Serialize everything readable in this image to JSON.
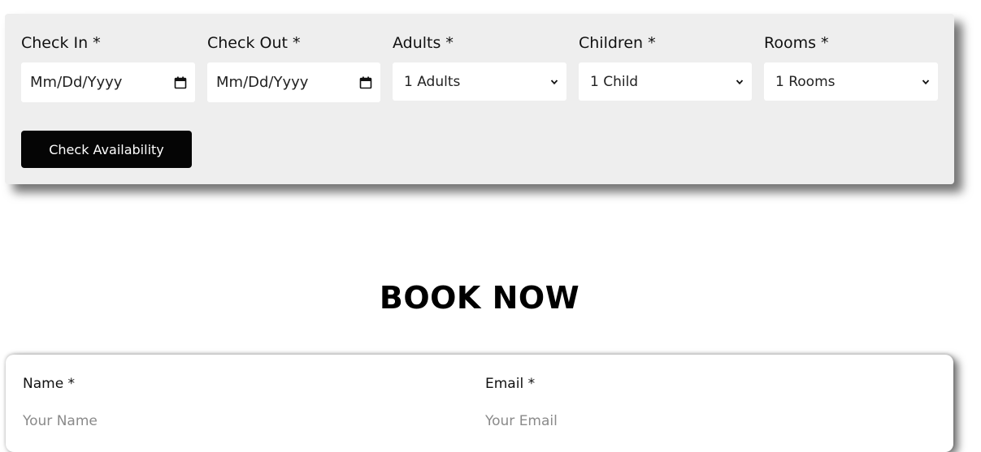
{
  "availability": {
    "fields": [
      {
        "label": "Check In *",
        "value": "Mm/Dd/Yyyy",
        "kind": "date",
        "icon": "calendar-icon"
      },
      {
        "label": "Check Out *",
        "value": "Mm/Dd/Yyyy",
        "kind": "date",
        "icon": "calendar-icon"
      },
      {
        "label": "Adults *",
        "value": "1 Adults",
        "kind": "select",
        "icon": "chevron-down-icon"
      },
      {
        "label": "Children *",
        "value": "1 Child",
        "kind": "select",
        "icon": "chevron-down-icon"
      },
      {
        "label": "Rooms *",
        "value": "1 Rooms",
        "kind": "select",
        "icon": "chevron-down-icon"
      }
    ],
    "button_label": "Check Availability"
  },
  "booking": {
    "title": "BOOK NOW",
    "name_label": "Name *",
    "name_placeholder": "Your Name",
    "email_label": "Email *",
    "email_placeholder": "Your Email"
  },
  "colors": {
    "panel_bg": "#eeeeee",
    "button_bg": "#050505",
    "button_text": "#ffffff",
    "placeholder": "#8a8a8a"
  }
}
